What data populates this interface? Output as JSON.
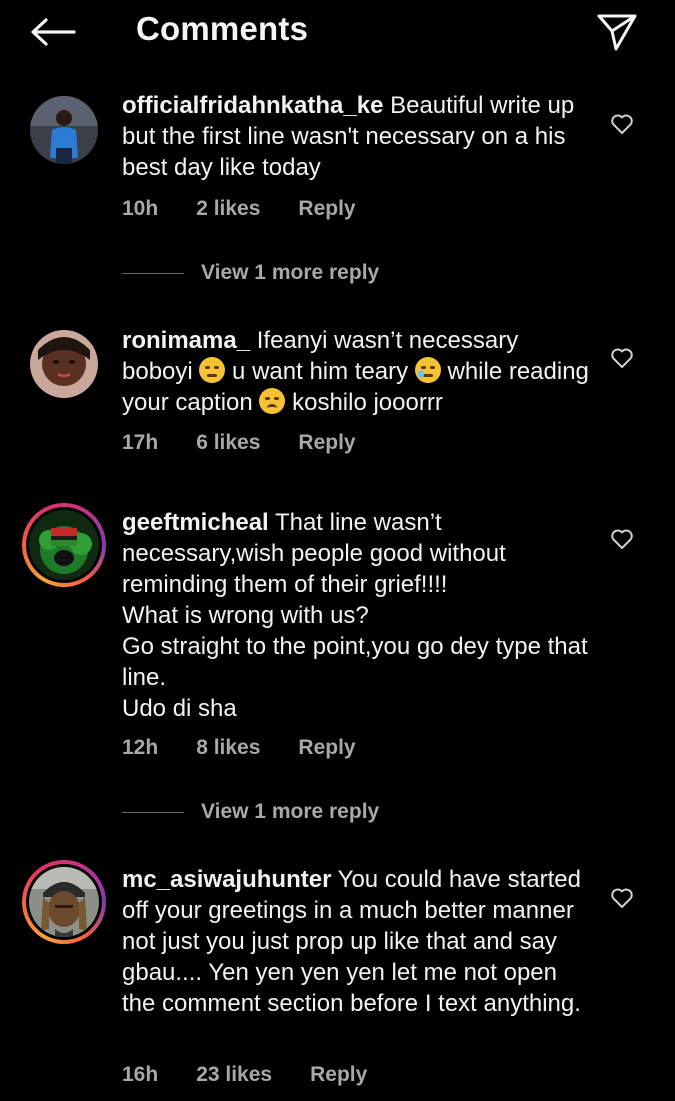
{
  "header": {
    "title": "Comments",
    "back_icon": "arrow-left-icon",
    "send_icon": "paper-plane-icon"
  },
  "comments": [
    {
      "username": "officialfridahnkatha_ke",
      "text": " Beautiful write up but the first line wasn't necessary on a his best day like today",
      "time": "10h",
      "likes": "2 likes",
      "reply": "Reply",
      "more_replies": "View 1 more reply"
    },
    {
      "username": "ronimama_",
      "text_parts": [
        " Ifeanyi wasn’t necessary boboyi ",
        " u want him teary ",
        " while reading your caption ",
        " koshilo jooorrr"
      ],
      "time": "17h",
      "likes": "6 likes",
      "reply": "Reply"
    },
    {
      "username": "geeftmicheal",
      "text": " That line wasn’t necessary,wish people good without reminding them of their grief!!!!\nWhat is wrong with us?\nGo straight to the point,you go dey type that line.\nUdo di sha",
      "time": "12h",
      "likes": "8 likes",
      "reply": "Reply",
      "more_replies": "View 1 more reply"
    },
    {
      "username": "mc_asiwajuhunter",
      "text": " You could have started off your greetings in a much better manner not just you just prop up like that and say gbau.... Yen yen yen yen let me not open the comment section before I text anything.",
      "time": "16h",
      "likes": "23 likes",
      "reply": "Reply"
    }
  ],
  "colors": {
    "background": "#000000",
    "text": "#f2f2f2",
    "meta": "#a8a8a8",
    "story_ring": "#e1306c"
  }
}
